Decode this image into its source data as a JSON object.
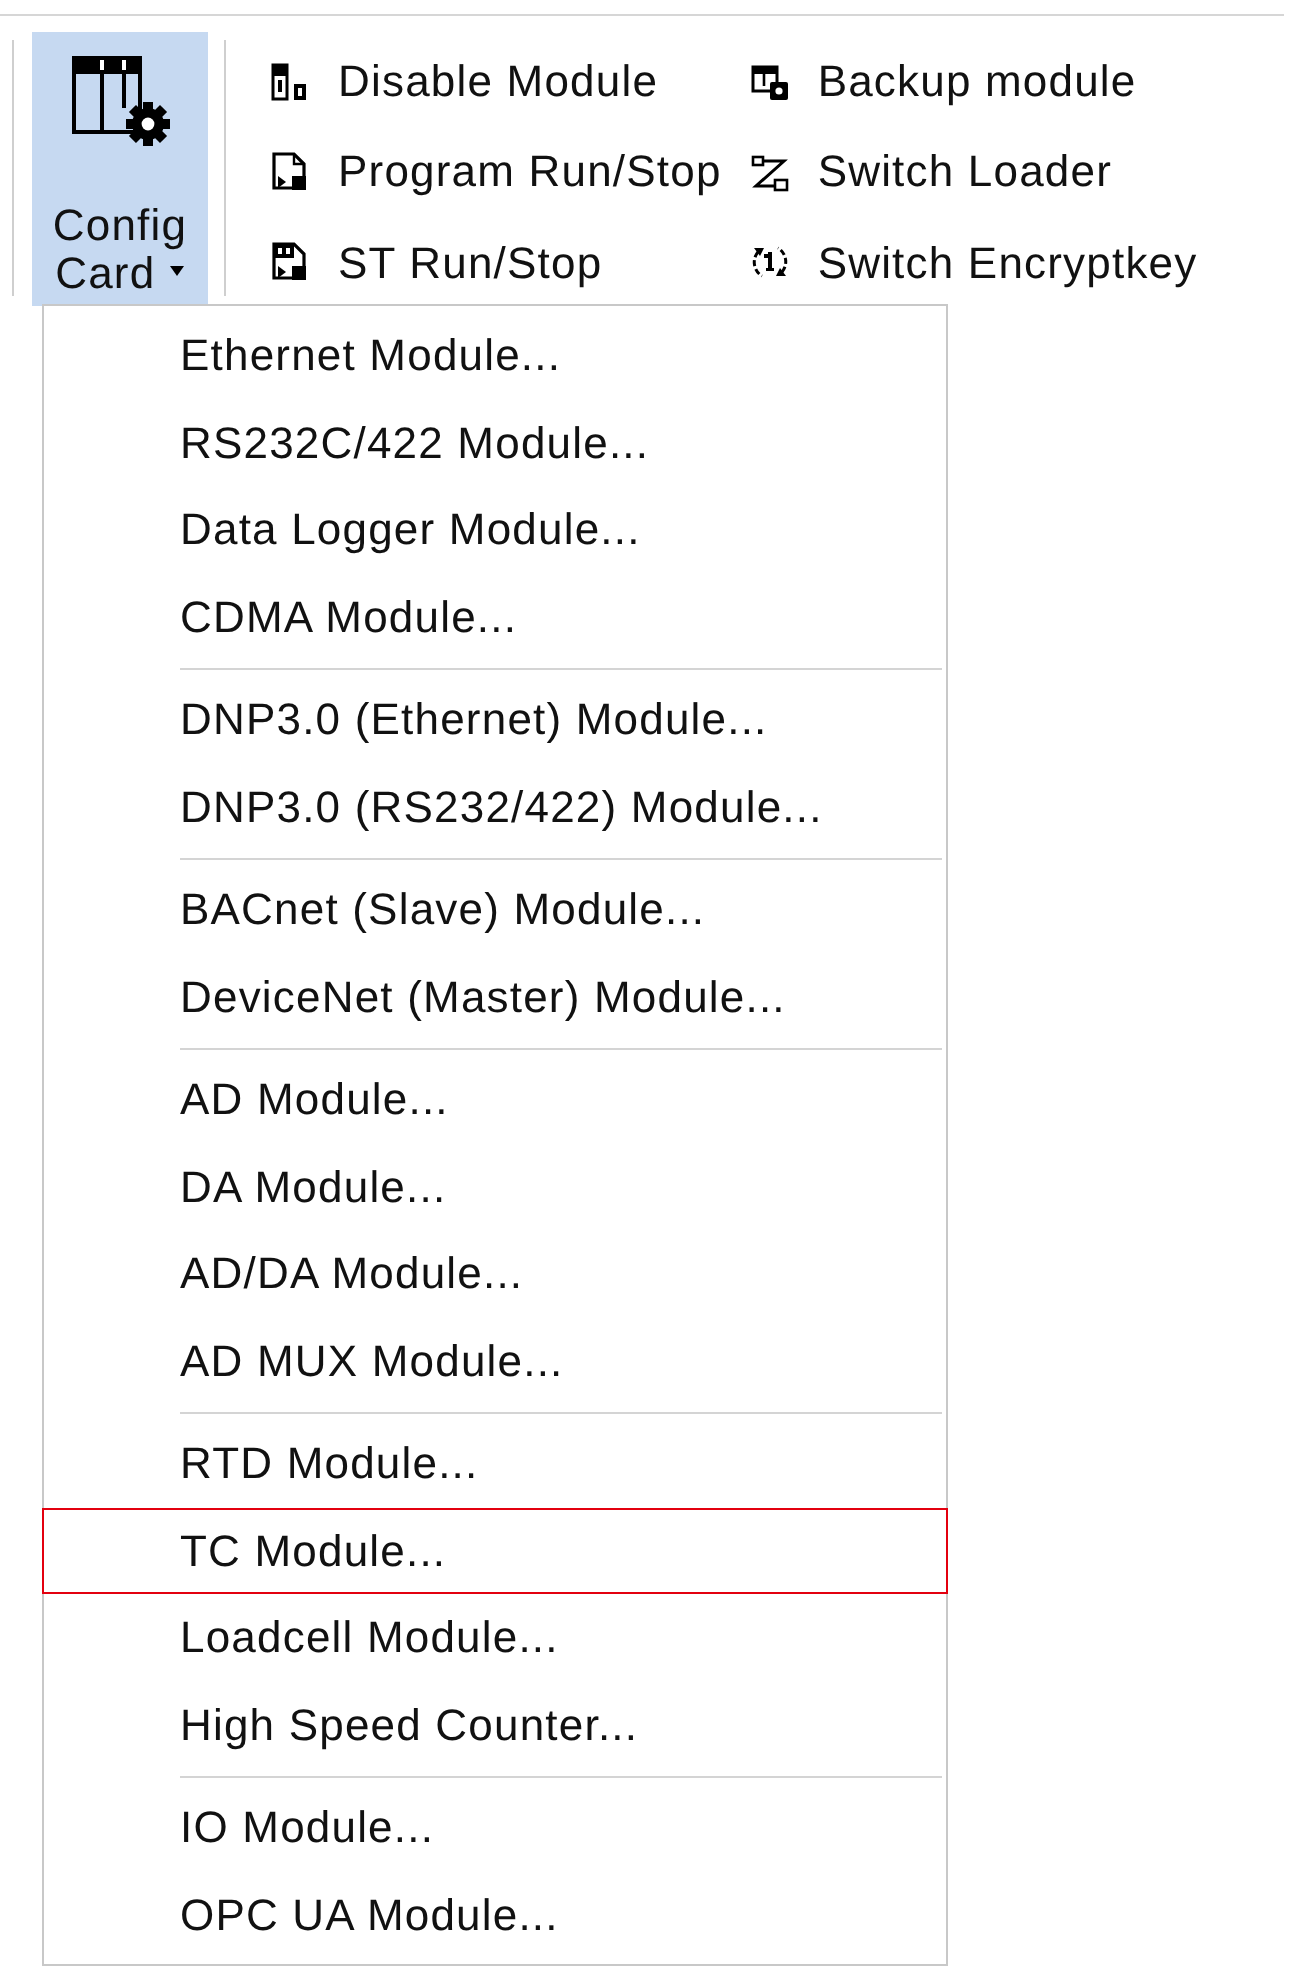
{
  "ribbon": {
    "config_button": {
      "label": "Config Card",
      "expanded": true
    },
    "commands": [
      {
        "label": "Disable Module"
      },
      {
        "label": "Program Run/Stop"
      },
      {
        "label": "ST Run/Stop"
      },
      {
        "label": "Backup module"
      },
      {
        "label": "Switch Loader"
      },
      {
        "label": "Switch Encryptkey"
      }
    ]
  },
  "menu": {
    "groups": [
      {
        "items": [
          {
            "label": "Ethernet Module...",
            "selected": false
          },
          {
            "label": "RS232C/422 Module...",
            "selected": false
          },
          {
            "label": "Data Logger Module...",
            "selected": false
          },
          {
            "label": "CDMA Module...",
            "selected": false
          }
        ]
      },
      {
        "items": [
          {
            "label": "DNP3.0 (Ethernet) Module...",
            "selected": false
          },
          {
            "label": "DNP3.0 (RS232/422) Module...",
            "selected": false
          }
        ]
      },
      {
        "items": [
          {
            "label": "BACnet (Slave) Module...",
            "selected": false
          },
          {
            "label": "DeviceNet (Master) Module...",
            "selected": false
          }
        ]
      },
      {
        "items": [
          {
            "label": "AD Module...",
            "selected": false
          },
          {
            "label": "DA Module...",
            "selected": false
          },
          {
            "label": "AD/DA Module...",
            "selected": false
          },
          {
            "label": "AD MUX Module...",
            "selected": false
          }
        ]
      },
      {
        "items": [
          {
            "label": "RTD Module...",
            "selected": false
          },
          {
            "label": "TC Module...",
            "selected": true
          },
          {
            "label": "Loadcell Module...",
            "selected": false
          },
          {
            "label": "High Speed Counter...",
            "selected": false
          }
        ]
      },
      {
        "items": [
          {
            "label": "IO Module...",
            "selected": false
          },
          {
            "label": "OPC UA Module...",
            "selected": false
          }
        ]
      }
    ]
  }
}
